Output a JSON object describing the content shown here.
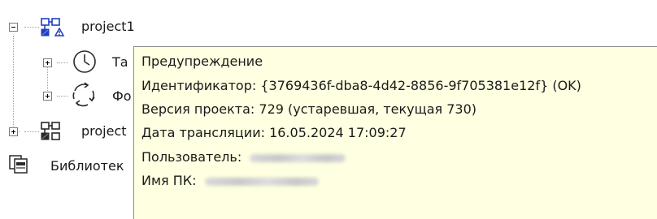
{
  "tree": {
    "nodes": [
      {
        "label": "project1",
        "state": "expanded",
        "icon": "project-warning-icon"
      },
      {
        "label": "Та",
        "state": "collapsed",
        "icon": "clock-icon"
      },
      {
        "label": "Фо",
        "state": "collapsed",
        "icon": "refresh-cycle-icon"
      },
      {
        "label": "project",
        "state": "collapsed",
        "icon": "project-icon"
      },
      {
        "label": "Библиотек",
        "state": "leaf",
        "icon": "library-icon"
      }
    ]
  },
  "tooltip": {
    "title": "Предупреждение",
    "identifier": "Идентификатор: {3769436f-dba8-4d42-8856-9f705381e12f} (OK)",
    "version": "Версия проекта: 729 (устаревшая, текущая 730)",
    "translation_date": "Дата трансляции: 16.05.2024 17:09:27",
    "user_label": "Пользователь:",
    "pc_label": "Имя ПК:"
  }
}
